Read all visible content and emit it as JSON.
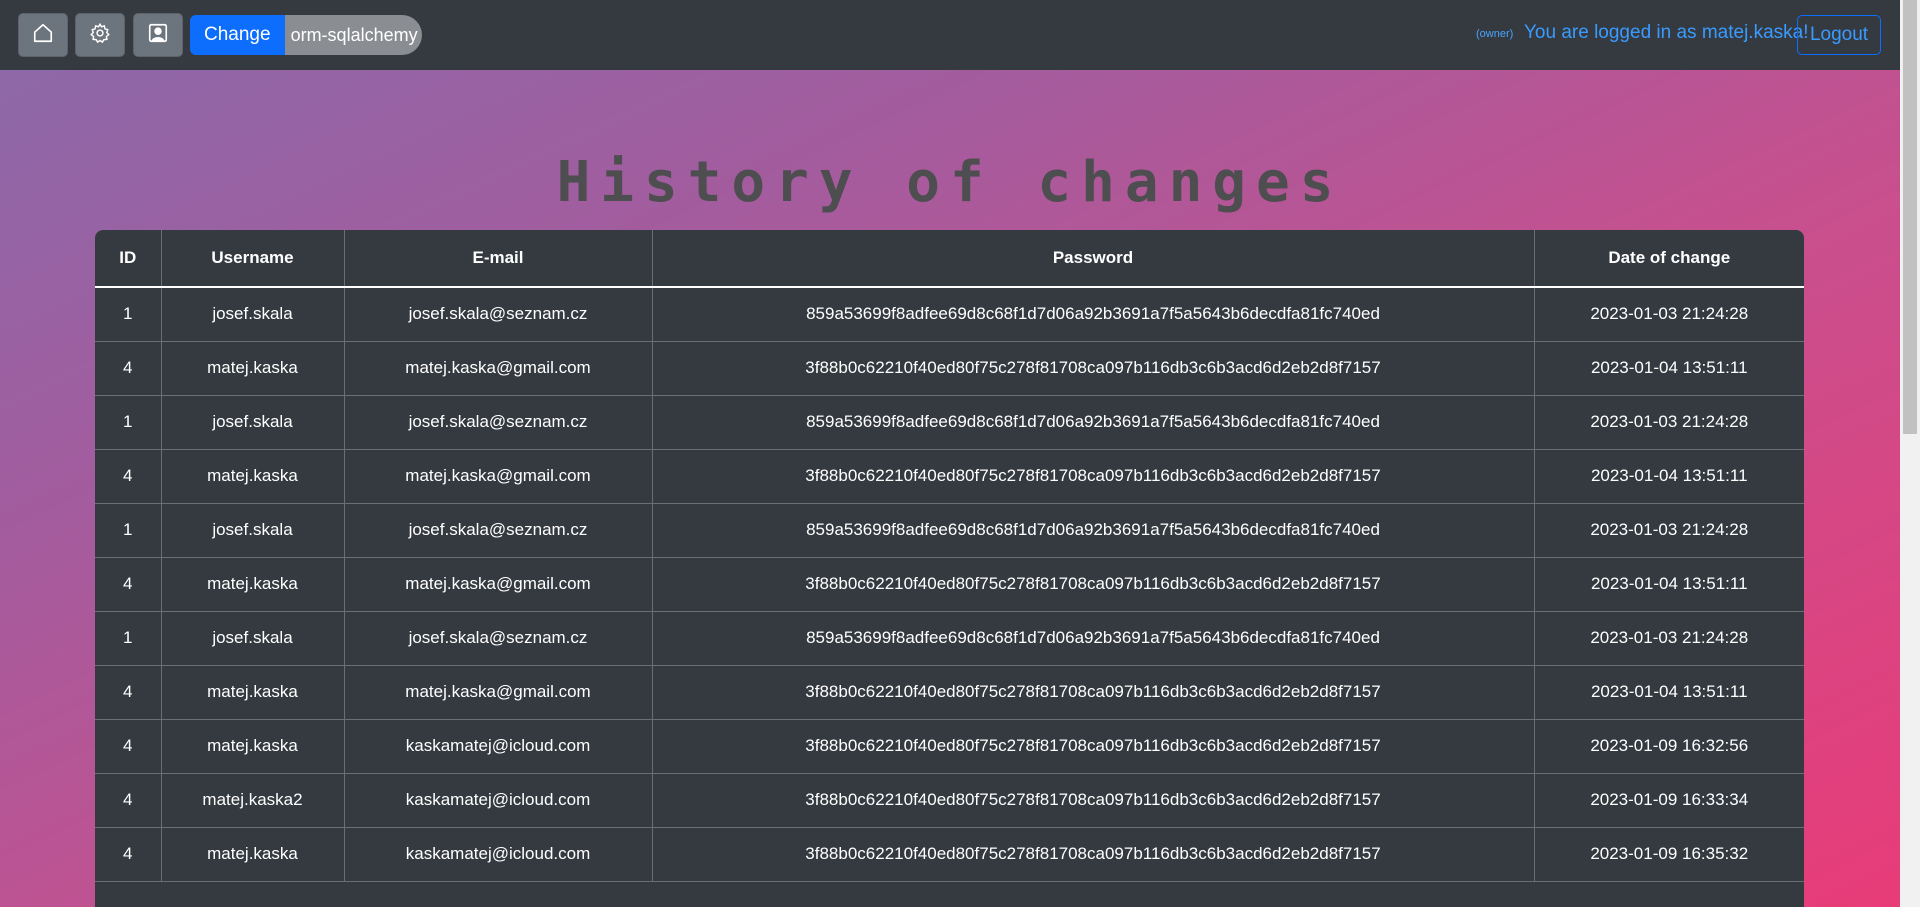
{
  "navbar": {
    "icons": {
      "home": "home-icon",
      "settings": "gear-icon",
      "profile": "user-portrait-icon"
    },
    "change_label": "Change",
    "repo_name": "orm-sqlalchemy",
    "role": "(owner)",
    "login_text": "You are logged in as matej.kaska!",
    "logout_label": "Logout"
  },
  "page": {
    "title": "History of changes"
  },
  "table": {
    "headers": [
      "ID",
      "Username",
      "E-mail",
      "Password",
      "Date of change"
    ],
    "rows": [
      [
        "1",
        "josef.skala",
        "josef.skala@seznam.cz",
        "859a53699f8adfee69d8c68f1d7d06a92b3691a7f5a5643b6decdfa81fc740ed",
        "2023-01-03 21:24:28"
      ],
      [
        "4",
        "matej.kaska",
        "matej.kaska@gmail.com",
        "3f88b0c62210f40ed80f75c278f81708ca097b116db3c6b3acd6d2eb2d8f7157",
        "2023-01-04 13:51:11"
      ],
      [
        "1",
        "josef.skala",
        "josef.skala@seznam.cz",
        "859a53699f8adfee69d8c68f1d7d06a92b3691a7f5a5643b6decdfa81fc740ed",
        "2023-01-03 21:24:28"
      ],
      [
        "4",
        "matej.kaska",
        "matej.kaska@gmail.com",
        "3f88b0c62210f40ed80f75c278f81708ca097b116db3c6b3acd6d2eb2d8f7157",
        "2023-01-04 13:51:11"
      ],
      [
        "1",
        "josef.skala",
        "josef.skala@seznam.cz",
        "859a53699f8adfee69d8c68f1d7d06a92b3691a7f5a5643b6decdfa81fc740ed",
        "2023-01-03 21:24:28"
      ],
      [
        "4",
        "matej.kaska",
        "matej.kaska@gmail.com",
        "3f88b0c62210f40ed80f75c278f81708ca097b116db3c6b3acd6d2eb2d8f7157",
        "2023-01-04 13:51:11"
      ],
      [
        "1",
        "josef.skala",
        "josef.skala@seznam.cz",
        "859a53699f8adfee69d8c68f1d7d06a92b3691a7f5a5643b6decdfa81fc740ed",
        "2023-01-03 21:24:28"
      ],
      [
        "4",
        "matej.kaska",
        "matej.kaska@gmail.com",
        "3f88b0c62210f40ed80f75c278f81708ca097b116db3c6b3acd6d2eb2d8f7157",
        "2023-01-04 13:51:11"
      ],
      [
        "4",
        "matej.kaska",
        "kaskamatej@icloud.com",
        "3f88b0c62210f40ed80f75c278f81708ca097b116db3c6b3acd6d2eb2d8f7157",
        "2023-01-09 16:32:56"
      ],
      [
        "4",
        "matej.kaska2",
        "kaskamatej@icloud.com",
        "3f88b0c62210f40ed80f75c278f81708ca097b116db3c6b3acd6d2eb2d8f7157",
        "2023-01-09 16:33:34"
      ],
      [
        "4",
        "matej.kaska",
        "kaskamatej@icloud.com",
        "3f88b0c62210f40ed80f75c278f81708ca097b116db3c6b3acd6d2eb2d8f7157",
        "2023-01-09 16:35:32"
      ]
    ]
  },
  "colors": {
    "navbar": "#343a40",
    "primary": "#0d6efd",
    "table": "#343a40",
    "title": "#4e4e50"
  }
}
